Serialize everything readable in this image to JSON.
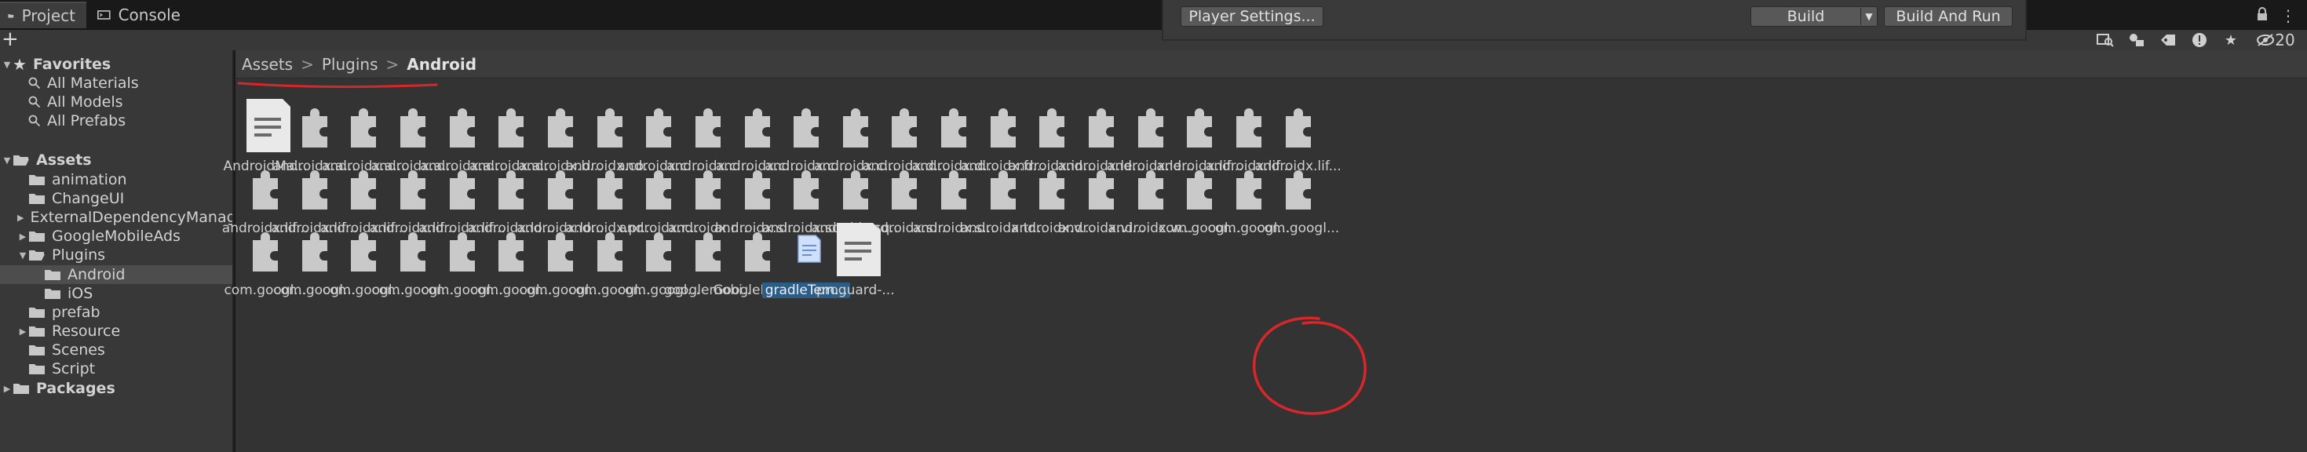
{
  "tabs": [
    {
      "label": "Project",
      "icon": "folder-icon",
      "active": true
    },
    {
      "label": "Console",
      "icon": "console-icon",
      "active": false
    }
  ],
  "tab_menu_glyph": "⋮",
  "build_panel": {
    "player_settings_label": "Player Settings...",
    "build_label": "Build",
    "build_and_run_label": "Build And Run"
  },
  "toolbar": {
    "add_glyph": "+",
    "hidden_count": "20",
    "icons": [
      "search-filter-icon",
      "type-filter-icon",
      "label-filter-icon",
      "warning-filter-icon",
      "favorite-icon",
      "visibility-icon"
    ]
  },
  "tree": {
    "rows": [
      {
        "label": "Favorites",
        "kind": "star",
        "indent": 0,
        "expanded": true,
        "bold": true
      },
      {
        "label": "All Materials",
        "kind": "search",
        "indent": 1
      },
      {
        "label": "All Models",
        "kind": "search",
        "indent": 1
      },
      {
        "label": "All Prefabs",
        "kind": "search",
        "indent": 1
      },
      {
        "label": "",
        "kind": "spacer",
        "indent": 0
      },
      {
        "label": "Assets",
        "kind": "folder-open",
        "indent": 0,
        "expanded": true,
        "bold": true
      },
      {
        "label": "animation",
        "kind": "folder",
        "indent": 1
      },
      {
        "label": "ChangeUI",
        "kind": "folder",
        "indent": 1
      },
      {
        "label": "ExternalDependencyManager",
        "kind": "folder",
        "indent": 1,
        "collapsed": true
      },
      {
        "label": "GoogleMobileAds",
        "kind": "folder",
        "indent": 1,
        "collapsed": true
      },
      {
        "label": "Plugins",
        "kind": "folder-open",
        "indent": 1,
        "expanded": true
      },
      {
        "label": "Android",
        "kind": "folder",
        "indent": 2,
        "selected": true
      },
      {
        "label": "iOS",
        "kind": "folder",
        "indent": 2
      },
      {
        "label": "prefab",
        "kind": "folder",
        "indent": 1
      },
      {
        "label": "Resource",
        "kind": "folder",
        "indent": 1,
        "collapsed": true
      },
      {
        "label": "Scenes",
        "kind": "folder",
        "indent": 1
      },
      {
        "label": "Script",
        "kind": "folder",
        "indent": 1
      },
      {
        "label": "Packages",
        "kind": "folder",
        "indent": 0,
        "collapsed": true,
        "bold": true
      }
    ]
  },
  "breadcrumb": {
    "items": [
      "Assets",
      "Plugins"
    ],
    "current": "Android",
    "separator": ">"
  },
  "assets": [
    {
      "label": "AndroidMa...",
      "type": "doc"
    },
    {
      "label": "androidx.a...",
      "type": "plugin"
    },
    {
      "label": "androidx.a...",
      "type": "plugin"
    },
    {
      "label": "androidx.a...",
      "type": "plugin"
    },
    {
      "label": "androidx.a...",
      "type": "plugin"
    },
    {
      "label": "androidx.a...",
      "type": "plugin"
    },
    {
      "label": "androidx.b...",
      "type": "plugin"
    },
    {
      "label": "androidx.co...",
      "type": "plugin"
    },
    {
      "label": "androidx.c...",
      "type": "plugin"
    },
    {
      "label": "androidx.c...",
      "type": "plugin"
    },
    {
      "label": "androidx.c...",
      "type": "plugin"
    },
    {
      "label": "androidx.c...",
      "type": "plugin"
    },
    {
      "label": "androidx.c...",
      "type": "plugin"
    },
    {
      "label": "androidx.d...",
      "type": "plugin"
    },
    {
      "label": "androidx.d...",
      "type": "plugin"
    },
    {
      "label": "androidx.fr...",
      "type": "plugin"
    },
    {
      "label": "androidx.in...",
      "type": "plugin"
    },
    {
      "label": "androidx.le...",
      "type": "plugin"
    },
    {
      "label": "androidx.le...",
      "type": "plugin"
    },
    {
      "label": "androidx.lif...",
      "type": "plugin"
    },
    {
      "label": "androidx.lif...",
      "type": "plugin"
    },
    {
      "label": "androidx.lif...",
      "type": "plugin"
    },
    {
      "label": "androidx.lif...",
      "type": "plugin"
    },
    {
      "label": "androidx.lif...",
      "type": "plugin"
    },
    {
      "label": "androidx.lif...",
      "type": "plugin"
    },
    {
      "label": "androidx.lif...",
      "type": "plugin"
    },
    {
      "label": "androidx.lif...",
      "type": "plugin"
    },
    {
      "label": "androidx.lo...",
      "type": "plugin"
    },
    {
      "label": "androidx.lo...",
      "type": "plugin"
    },
    {
      "label": "androidx.pr...",
      "type": "plugin"
    },
    {
      "label": "androidx.r...",
      "type": "plugin"
    },
    {
      "label": "androidx.r...",
      "type": "plugin"
    },
    {
      "label": "androidx.sl...",
      "type": "plugin"
    },
    {
      "label": "androidx.sq...",
      "type": "plugin"
    },
    {
      "label": "androidx.sq...",
      "type": "plugin"
    },
    {
      "label": "androidx.s...",
      "type": "plugin"
    },
    {
      "label": "androidx.s...",
      "type": "plugin"
    },
    {
      "label": "androidx.tr...",
      "type": "plugin"
    },
    {
      "label": "androidx.v...",
      "type": "plugin"
    },
    {
      "label": "androidx.vi...",
      "type": "plugin"
    },
    {
      "label": "androidx.w...",
      "type": "plugin"
    },
    {
      "label": "com.googl...",
      "type": "plugin"
    },
    {
      "label": "com.googl...",
      "type": "plugin"
    },
    {
      "label": "com.googl...",
      "type": "plugin"
    },
    {
      "label": "com.googl...",
      "type": "plugin"
    },
    {
      "label": "com.googl...",
      "type": "plugin"
    },
    {
      "label": "com.googl...",
      "type": "plugin"
    },
    {
      "label": "com.googl...",
      "type": "plugin"
    },
    {
      "label": "com.googl...",
      "type": "plugin"
    },
    {
      "label": "com.googl...",
      "type": "plugin"
    },
    {
      "label": "com.googl...",
      "type": "plugin"
    },
    {
      "label": "com.googl...",
      "type": "plugin"
    },
    {
      "label": "com.googl...",
      "type": "plugin"
    },
    {
      "label": "googlemobi...",
      "type": "plugin"
    },
    {
      "label": "GoogleMobi...",
      "type": "plugin"
    },
    {
      "label": "gradleTem...",
      "type": "gradle",
      "selected": true
    },
    {
      "label": "proguard-...",
      "type": "doc"
    }
  ],
  "colors": {
    "annotation_red": "#d8262a",
    "selection_blue": "#2c5d87"
  }
}
